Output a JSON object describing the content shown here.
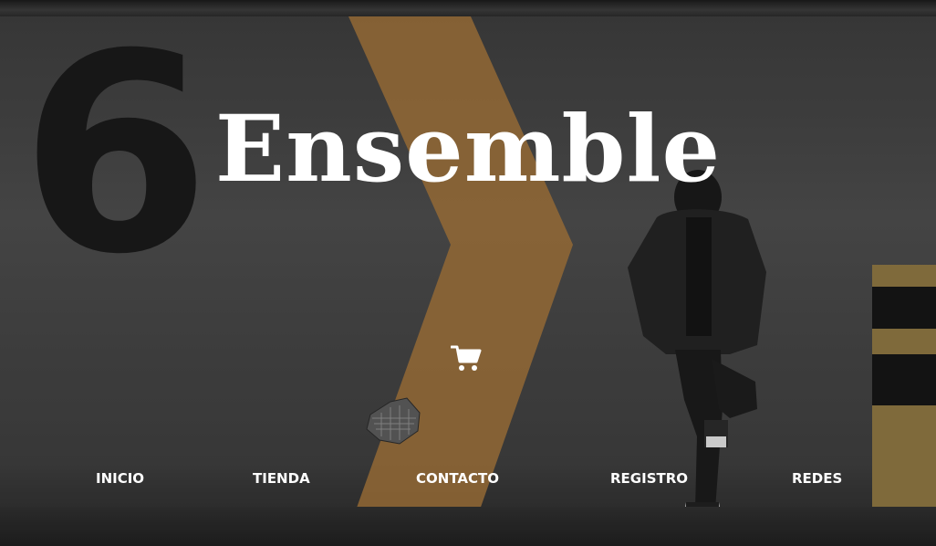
{
  "hero": {
    "brand_name": "Ensemble",
    "wall_number": "6"
  },
  "cart": {
    "icon": "shopping-cart-icon"
  },
  "nav": {
    "items": [
      {
        "label": "INICIO"
      },
      {
        "label": "TIENDA"
      },
      {
        "label": "CONTACTO"
      },
      {
        "label": "REGISTRO"
      },
      {
        "label": "REDES"
      }
    ]
  },
  "colors": {
    "text": "#ffffff",
    "chevron": "#a0723a",
    "wall": "#4a4a4a"
  }
}
